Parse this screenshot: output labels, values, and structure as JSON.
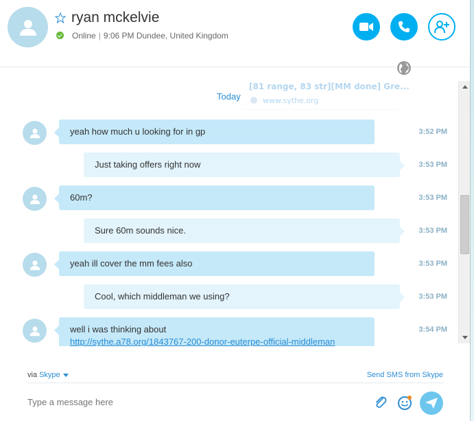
{
  "contact": {
    "name": "ryan mckelvie",
    "presence": "Online",
    "local_time": "9:06 PM Dundee, United Kingdom"
  },
  "colors": {
    "accent": "#00aff0",
    "online": "#68b93b",
    "incoming_bubble": "#c5e9f9",
    "outgoing_bubble": "#e3f4fc",
    "link": "#2a8dd4"
  },
  "icons": {
    "avatar": "person-silhouette-icon",
    "favorite": "star-outline-icon",
    "video": "video-camera-icon",
    "call": "phone-icon",
    "add_people": "add-person-icon",
    "globe": "globe-icon",
    "attach": "paperclip-icon",
    "emoji": "emoticon-icon",
    "send": "paper-plane-icon"
  },
  "chat": {
    "date_divider": "Today",
    "ghost_preview": {
      "title": "[81 range, 83 str][MM done] Gre...",
      "url": "www.sythe.org"
    },
    "messages": [
      {
        "direction": "in",
        "text": "yeah how much u looking for in gp",
        "time": "3:52 PM"
      },
      {
        "direction": "out",
        "text": "Just taking offers right now",
        "time": "3:53 PM"
      },
      {
        "direction": "in",
        "text": "60m?",
        "time": "3:53 PM"
      },
      {
        "direction": "out",
        "text": "Sure 60m sounds nice.",
        "time": "3:53 PM"
      },
      {
        "direction": "in",
        "text": "yeah ill cover the mm fees also",
        "time": "3:53 PM"
      },
      {
        "direction": "out",
        "text": "Cool, which middleman we using?",
        "time": "3:53 PM"
      },
      {
        "direction": "in",
        "text": "well i was thinking about",
        "link": "http://sythe.a78.org/1843767-200-donor-euterpe-official-middleman",
        "time": "3:54 PM"
      }
    ]
  },
  "footer": {
    "via_label": "via",
    "via_service": "Skype",
    "send_sms": "Send SMS from Skype",
    "composer_placeholder": "Type a message here"
  }
}
